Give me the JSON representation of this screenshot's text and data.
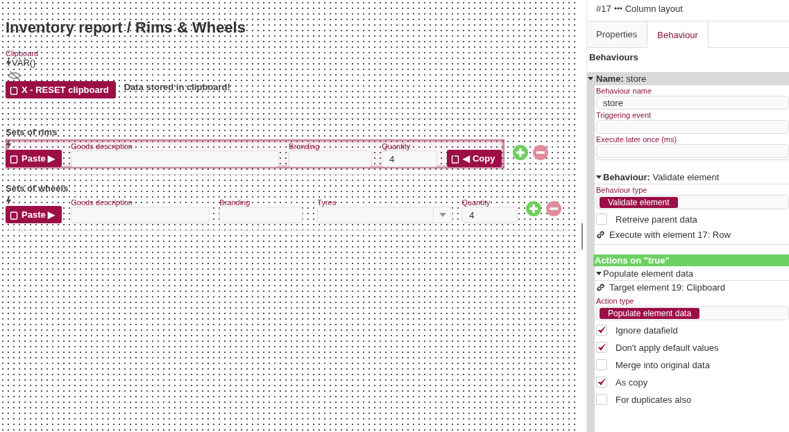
{
  "page_title": "Inventory report / Rims & Wheels",
  "clipboard": {
    "label": "Clipboard",
    "value": "VAR()",
    "button": "X - RESET clipboard",
    "message": "Data stored in clipboard!"
  },
  "sections": [
    {
      "title": "Sets of rims",
      "highlighted": true,
      "paste_button": "Paste ▶",
      "copy_button": "◀ Copy",
      "fields": [
        {
          "kind": "text",
          "label": "Goods description"
        },
        {
          "kind": "text",
          "label": "Branding"
        },
        {
          "kind": "text",
          "label": "Quantity",
          "value": "4"
        }
      ]
    },
    {
      "title": "Sets of wheels",
      "highlighted": false,
      "paste_button": "Paste ▶",
      "fields": [
        {
          "kind": "text",
          "label": "Goods description"
        },
        {
          "kind": "text",
          "label": "Branding"
        },
        {
          "kind": "select",
          "label": "Tyres"
        },
        {
          "kind": "text",
          "label": "Quantity",
          "value": "4"
        }
      ]
    }
  ],
  "panel": {
    "element_id": "#17",
    "element_type": "Column layout",
    "tabs": [
      {
        "label": "Properties",
        "selected": false
      },
      {
        "label": "Behaviour",
        "selected": true
      }
    ],
    "heading": "Behaviours",
    "group_header": "**Name:** store",
    "items": [
      {
        "kind": "label",
        "text": "Behaviour name"
      },
      {
        "kind": "input",
        "value": "store"
      },
      {
        "kind": "label",
        "text": "Triggering event"
      },
      {
        "kind": "input"
      },
      {
        "kind": "label",
        "text": "Execute later once (ms)"
      },
      {
        "kind": "input"
      },
      {
        "kind": "spacer"
      },
      {
        "kind": "subheader",
        "text": "**Behaviour:** Validate element",
        "expanded": true
      },
      {
        "kind": "label",
        "text": "Behaviour type"
      },
      {
        "kind": "tag",
        "text": "Validate element"
      },
      {
        "kind": "checkbox",
        "text": "Retreive parent data",
        "checked": false
      },
      {
        "kind": "link",
        "text": "Execute with element 17: Row"
      },
      {
        "kind": "spacer"
      },
      {
        "kind": "banner",
        "text": "**Actions on \"true\"**"
      },
      {
        "kind": "subheader",
        "text": "Populate element data",
        "expanded": true
      },
      {
        "kind": "link",
        "text": "Target element 19: Clipboard"
      },
      {
        "kind": "label",
        "text": "Action type"
      },
      {
        "kind": "tag",
        "text": "Populate element data"
      },
      {
        "kind": "checkbox",
        "text": "Ignore datafield",
        "checked": true
      },
      {
        "kind": "checkbox",
        "text": "Don't apply default values",
        "checked": true
      },
      {
        "kind": "checkbox",
        "text": "Merge into original data",
        "checked": false
      },
      {
        "kind": "checkbox",
        "text": "As copy",
        "checked": true
      },
      {
        "kind": "checkbox",
        "text": "For duplicates also",
        "checked": false
      }
    ]
  }
}
